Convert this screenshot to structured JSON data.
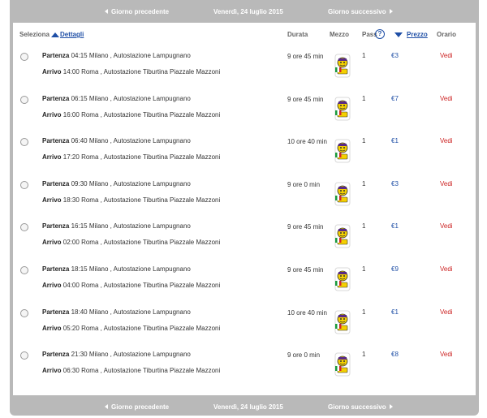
{
  "nav": {
    "prev_label": "Giorno precedente",
    "date": "Venerdì, 24 luglio 2015",
    "next_label": "Giorno successivo"
  },
  "header": {
    "seleziona": "Seleziona",
    "dettagli": "Dettagli",
    "durata": "Durata",
    "mezzo": "Mezzo",
    "pass": "Pass",
    "help": "?",
    "prezzo": "Prezzo",
    "orario": "Orario"
  },
  "labels": {
    "partenza": "Partenza",
    "arrivo": "Arrivo"
  },
  "rows": [
    {
      "dep_time": "04:15",
      "dep_place": "Milano , Autostazione Lampugnano",
      "arr_time": "14:00",
      "arr_place": "Roma , Autostazione Tiburtina Piazzale Mazzoni",
      "durata": "9 ore 45 min",
      "pass": "1",
      "prezzo": "€3",
      "orario": "Vedi"
    },
    {
      "dep_time": "06:15",
      "dep_place": "Milano , Autostazione Lampugnano",
      "arr_time": "16:00",
      "arr_place": "Roma , Autostazione Tiburtina Piazzale Mazzoni",
      "durata": "9 ore 45 min",
      "pass": "1",
      "prezzo": "€7",
      "orario": "Vedi"
    },
    {
      "dep_time": "06:40",
      "dep_place": "Milano , Autostazione Lampugnano",
      "arr_time": "17:20",
      "arr_place": "Roma , Autostazione Tiburtina Piazzale Mazzoni",
      "durata": "10 ore 40 min",
      "pass": "1",
      "prezzo": "€1",
      "orario": "Vedi"
    },
    {
      "dep_time": "09:30",
      "dep_place": "Milano , Autostazione Lampugnano",
      "arr_time": "18:30",
      "arr_place": "Roma , Autostazione Tiburtina Piazzale Mazzoni",
      "durata": "9 ore 0 min",
      "pass": "1",
      "prezzo": "€3",
      "orario": "Vedi"
    },
    {
      "dep_time": "16:15",
      "dep_place": "Milano , Autostazione Lampugnano",
      "arr_time": "02:00",
      "arr_place": "Roma , Autostazione Tiburtina Piazzale Mazzoni",
      "durata": "9 ore 45 min",
      "pass": "1",
      "prezzo": "€1",
      "orario": "Vedi"
    },
    {
      "dep_time": "18:15",
      "dep_place": "Milano , Autostazione Lampugnano",
      "arr_time": "04:00",
      "arr_place": "Roma , Autostazione Tiburtina Piazzale Mazzoni",
      "durata": "9 ore 45 min",
      "pass": "1",
      "prezzo": "€9",
      "orario": "Vedi"
    },
    {
      "dep_time": "18:40",
      "dep_place": "Milano , Autostazione Lampugnano",
      "arr_time": "05:20",
      "arr_place": "Roma , Autostazione Tiburtina Piazzale Mazzoni",
      "durata": "10 ore 40 min",
      "pass": "1",
      "prezzo": "€1",
      "orario": "Vedi"
    },
    {
      "dep_time": "21:30",
      "dep_place": "Milano , Autostazione Lampugnano",
      "arr_time": "06:30",
      "arr_place": "Roma , Autostazione Tiburtina Piazzale Mazzoni",
      "durata": "9 ore 0 min",
      "pass": "1",
      "prezzo": "€8",
      "orario": "Vedi"
    }
  ]
}
